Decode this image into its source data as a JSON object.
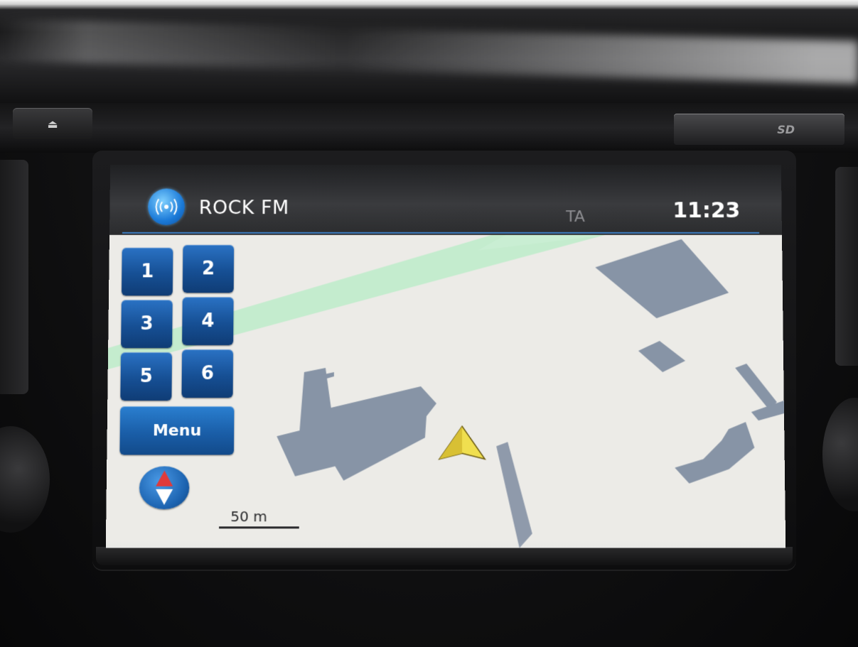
{
  "header": {
    "station_name": "ROCK FM",
    "ta_indicator": "TA",
    "clock": "11:23"
  },
  "icons": {
    "source": "radio-broadcast-icon",
    "eject": "eject-icon",
    "compass": "north-arrow-icon",
    "vehicle": "vehicle-position-arrow-icon"
  },
  "presets": [
    {
      "label": "1"
    },
    {
      "label": "2"
    },
    {
      "label": "3"
    },
    {
      "label": "4"
    },
    {
      "label": "5"
    },
    {
      "label": "6"
    }
  ],
  "menu": {
    "label": "Menu"
  },
  "map": {
    "scale_label": "50 m"
  },
  "hardware": {
    "eject_glyph": "⏏",
    "sd_slot_label": "SD"
  },
  "colors": {
    "accent_blue": "#1b6fc4",
    "header_bg": "#2e2f31",
    "map_bg": "#ecebe7",
    "building": "#8794a6",
    "park_strip": "#bfe9c9",
    "vehicle_arrow": "#e8d24a"
  }
}
